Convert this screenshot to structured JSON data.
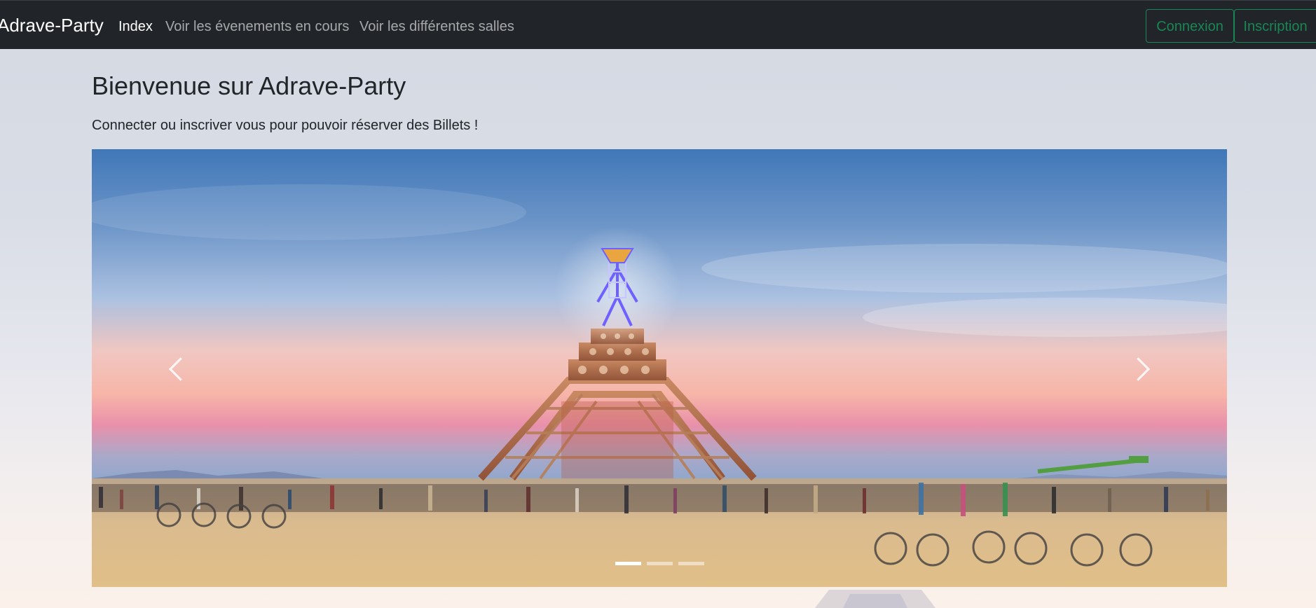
{
  "navbar": {
    "brand": "Adrave-Party",
    "links": [
      {
        "label": "Index",
        "active": true
      },
      {
        "label": "Voir les évenements en cours",
        "active": false
      },
      {
        "label": "Voir les différentes salles",
        "active": false
      }
    ],
    "buttons": {
      "login_label": "Connexion",
      "signup_label": "Inscription"
    }
  },
  "main": {
    "title": "Bienvenue sur Adrave-Party",
    "subtitle": "Connecter ou inscriver vous pour pouvoir réserver des Billets !"
  },
  "carousel": {
    "slide_count": 3,
    "active_slide": 1,
    "prev_icon": "chevron-left-icon",
    "next_icon": "chevron-right-icon"
  },
  "colors": {
    "navbar_bg": "#212529",
    "button_outline": "#198754",
    "text": "#212529"
  }
}
